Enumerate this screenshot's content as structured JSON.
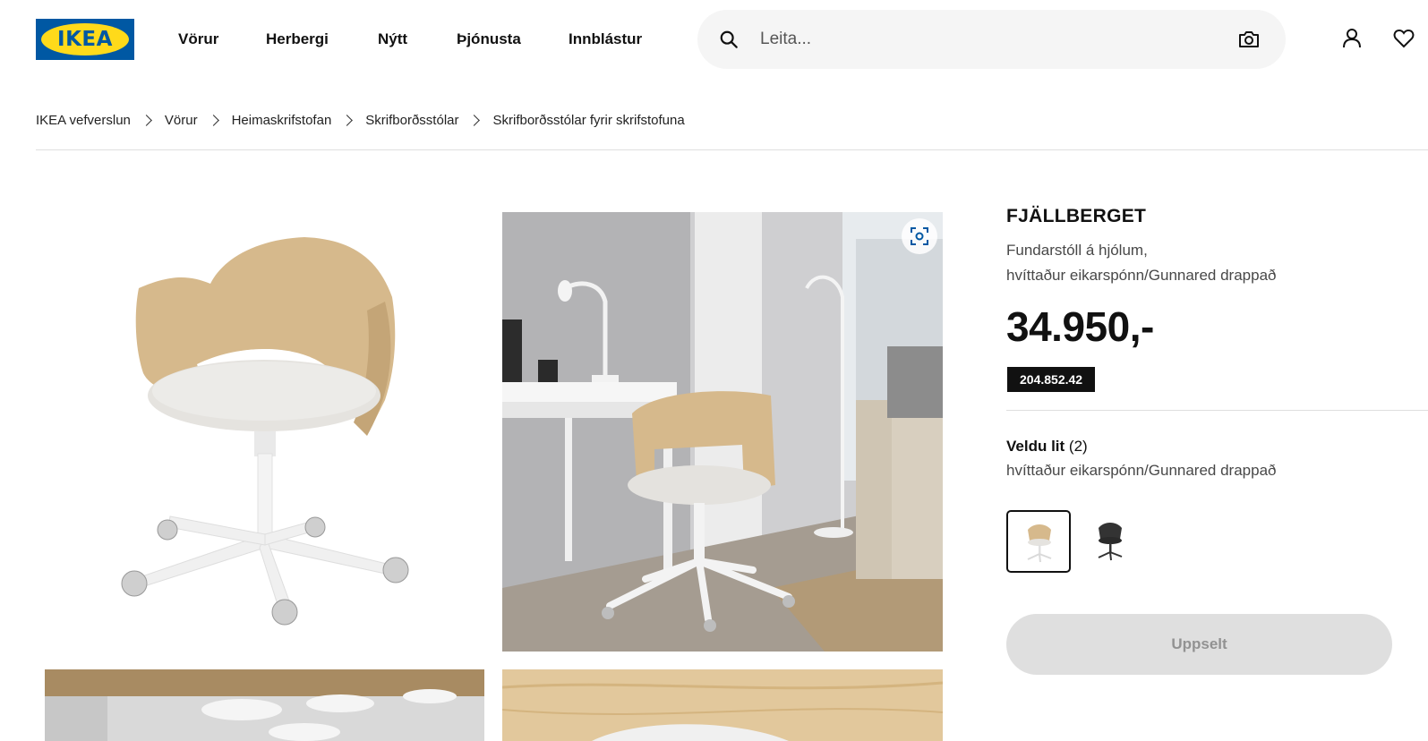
{
  "brand": {
    "logo_text": "IKEA",
    "blue": "#0058a3",
    "yellow": "#ffda1a"
  },
  "nav": {
    "items": [
      {
        "label": "Vörur"
      },
      {
        "label": "Herbergi"
      },
      {
        "label": "Nýtt"
      },
      {
        "label": "Þjónusta"
      },
      {
        "label": "Innblástur"
      }
    ]
  },
  "search": {
    "placeholder": "Leita...",
    "icon": "search-icon",
    "camera_icon": "camera-icon"
  },
  "header_icons": [
    "user-icon",
    "heart-icon"
  ],
  "breadcrumb": [
    "IKEA vefverslun",
    "Vörur",
    "Heimaskrifstofan",
    "Skrifborðsstólar",
    "Skrifborðsstólar fyrir skrifstofuna"
  ],
  "product": {
    "name": "FJÄLLBERGET",
    "type_line": "Fundarstóll á hjólum,",
    "variant_line": "hvíttaður eikarspónn/Gunnared drappað",
    "price": "34.950,-",
    "article_number": "204.852.42",
    "color_heading": "Veldu lit",
    "color_count": "(2)",
    "selected_color": "hvíttaður eikarspónn/Gunnared drappað",
    "buy_label": "Uppselt",
    "colors": {
      "veneer": "#d6b98c",
      "cushion": "#e5e3df",
      "frame": "#f1f1f1",
      "dark_chair": "#333333"
    }
  }
}
